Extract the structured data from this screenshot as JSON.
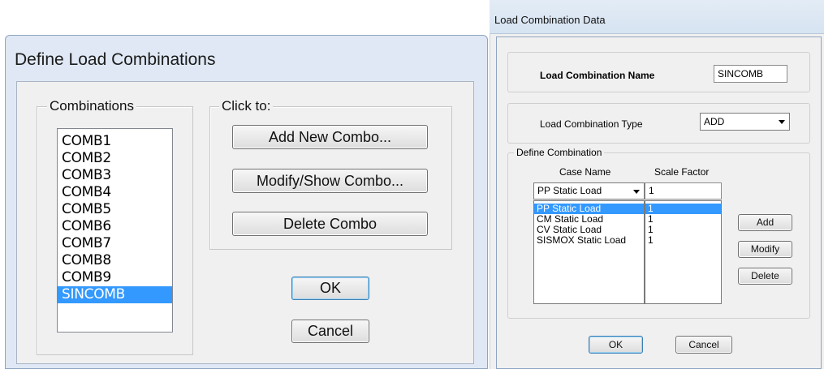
{
  "define_dialog": {
    "title": "Define Load Combinations",
    "combinations_label": "Combinations",
    "combinations": [
      "COMB1",
      "COMB2",
      "COMB3",
      "COMB4",
      "COMB5",
      "COMB6",
      "COMB7",
      "COMB8",
      "COMB9",
      "SINCOMB"
    ],
    "selected": "SINCOMB",
    "click_to_label": "Click to:",
    "add_button": "Add New Combo...",
    "modify_button": "Modify/Show Combo...",
    "delete_button": "Delete Combo",
    "ok_button": "OK",
    "cancel_button": "Cancel"
  },
  "data_dialog": {
    "title": "Load Combination Data",
    "name_label": "Load Combination Name",
    "name_value": "SINCOMB",
    "type_label": "Load Combination Type",
    "type_value": "ADD",
    "define_group_label": "Define Combination",
    "case_name_header": "Case Name",
    "scale_factor_header": "Scale Factor",
    "case_select_value": "PP Static Load",
    "scale_input_value": "1",
    "case_names": [
      "PP Static Load",
      "CM Static Load",
      "CV Static Load",
      "SISMOX Static Load"
    ],
    "scale_factors": [
      "1",
      "1",
      "1",
      "1"
    ],
    "add_button": "Add",
    "modify_button": "Modify",
    "delete_button": "Delete",
    "ok_button": "OK",
    "cancel_button": "Cancel"
  },
  "colors": {
    "selection": "#3399ff",
    "default_button_border": "#3c7fb1"
  }
}
